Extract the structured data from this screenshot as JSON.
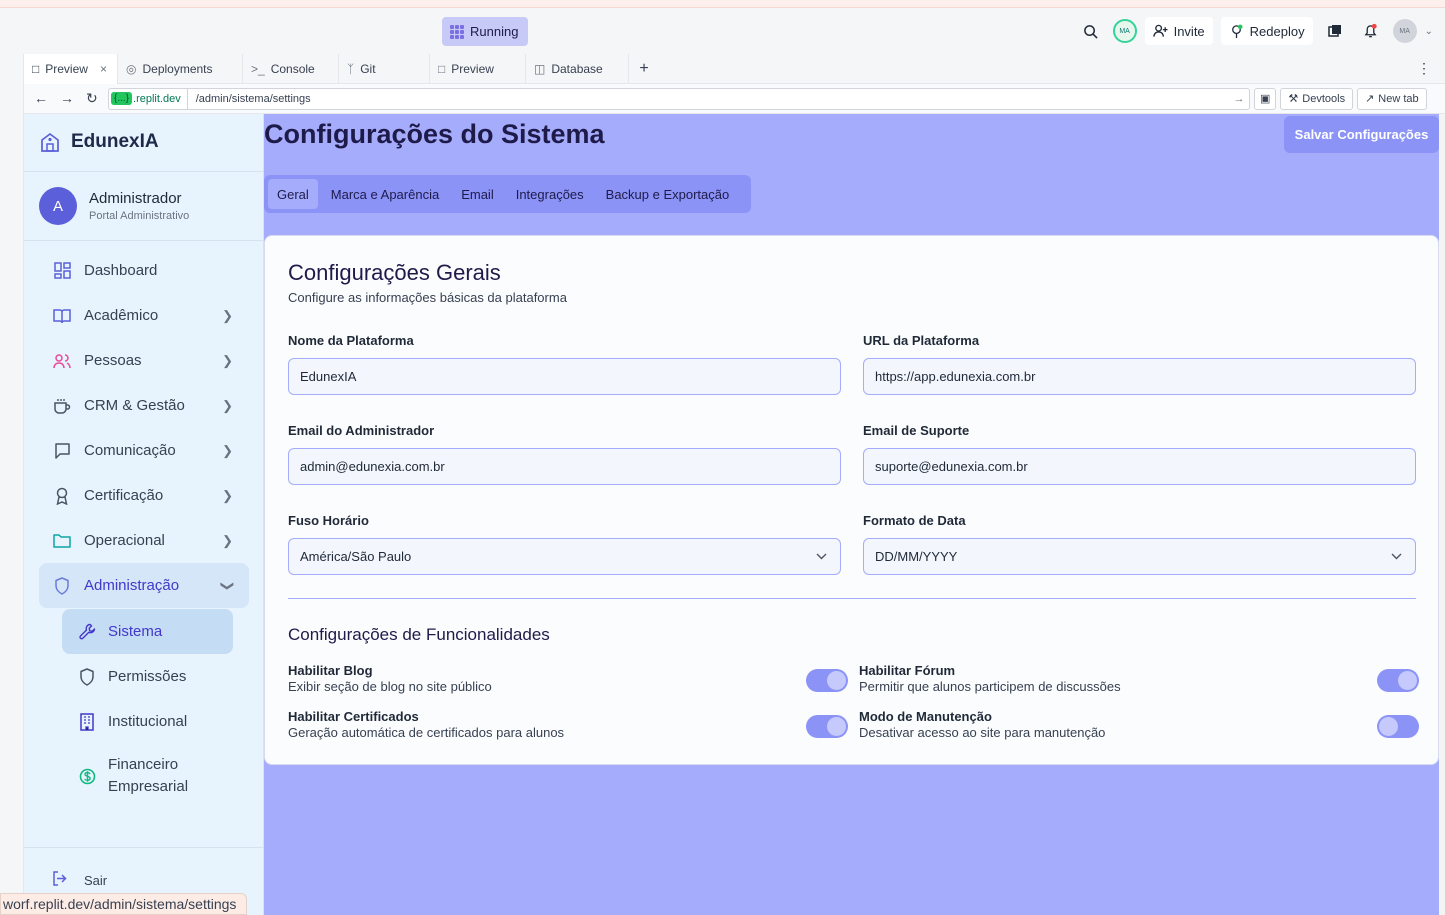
{
  "replit": {
    "run_status": "Running",
    "invite_label": "Invite",
    "redeploy_label": "Redeploy",
    "user_initials": "MA",
    "tabs": [
      {
        "label": "Preview"
      },
      {
        "label": "Deployments"
      },
      {
        "label": "Console"
      },
      {
        "label": "Git"
      },
      {
        "label": "Preview"
      },
      {
        "label": "Database"
      }
    ],
    "url_host_pill": "{...}",
    "url_host": ".replit.dev",
    "url_path": "/admin/sistema/settings",
    "devtools_label": "Devtools",
    "newtab_label": "New tab",
    "status_url": "worf.replit.dev/admin/sistema/settings"
  },
  "sidebar": {
    "brand": "EdunexIA",
    "user_initial": "A",
    "user_name": "Administrador",
    "user_role": "Portal Administrativo",
    "items": [
      {
        "label": "Dashboard"
      },
      {
        "label": "Acadêmico"
      },
      {
        "label": "Pessoas"
      },
      {
        "label": "CRM & Gestão"
      },
      {
        "label": "Comunicação"
      },
      {
        "label": "Certificação"
      },
      {
        "label": "Operacional"
      },
      {
        "label": "Administração"
      }
    ],
    "sub_items": [
      {
        "label": "Sistema"
      },
      {
        "label": "Permissões"
      },
      {
        "label": "Institucional"
      },
      {
        "label": "Financeiro Empresarial"
      }
    ],
    "logout": "Sair"
  },
  "main": {
    "title": "Configurações do Sistema",
    "save_label": "Salvar Configurações",
    "tabs": [
      {
        "label": "Geral"
      },
      {
        "label": "Marca e Aparência"
      },
      {
        "label": "Email"
      },
      {
        "label": "Integrações"
      },
      {
        "label": "Backup e Exportação"
      }
    ],
    "card_title": "Configurações Gerais",
    "card_subtitle": "Configure as informações básicas da plataforma",
    "fields": {
      "platform_name": {
        "label": "Nome da Plataforma",
        "value": "EdunexIA"
      },
      "platform_url": {
        "label": "URL da Plataforma",
        "value": "https://app.edunexia.com.br"
      },
      "admin_email": {
        "label": "Email do Administrador",
        "value": "admin@edunexia.com.br"
      },
      "support_email": {
        "label": "Email de Suporte",
        "value": "suporte@edunexia.com.br"
      },
      "timezone": {
        "label": "Fuso Horário",
        "value": "América/São Paulo"
      },
      "date_format": {
        "label": "Formato de Data",
        "value": "DD/MM/YYYY"
      }
    },
    "features_title": "Configurações de Funcionalidades",
    "features": [
      {
        "name": "Habilitar Blog",
        "desc": "Exibir seção de blog no site público",
        "enabled": true
      },
      {
        "name": "Habilitar Fórum",
        "desc": "Permitir que alunos participem de discussões",
        "enabled": true
      },
      {
        "name": "Habilitar Certificados",
        "desc": "Geração automática de certificados para alunos",
        "enabled": true
      },
      {
        "name": "Modo de Manutenção",
        "desc": "Desativar acesso ao site para manutenção",
        "enabled": false
      }
    ]
  },
  "colors": {
    "accent": "#5b5fd9",
    "main_bg": "#a5acfb",
    "button": "#8b93f6",
    "sidebar_bg": "#e8f4fd"
  }
}
